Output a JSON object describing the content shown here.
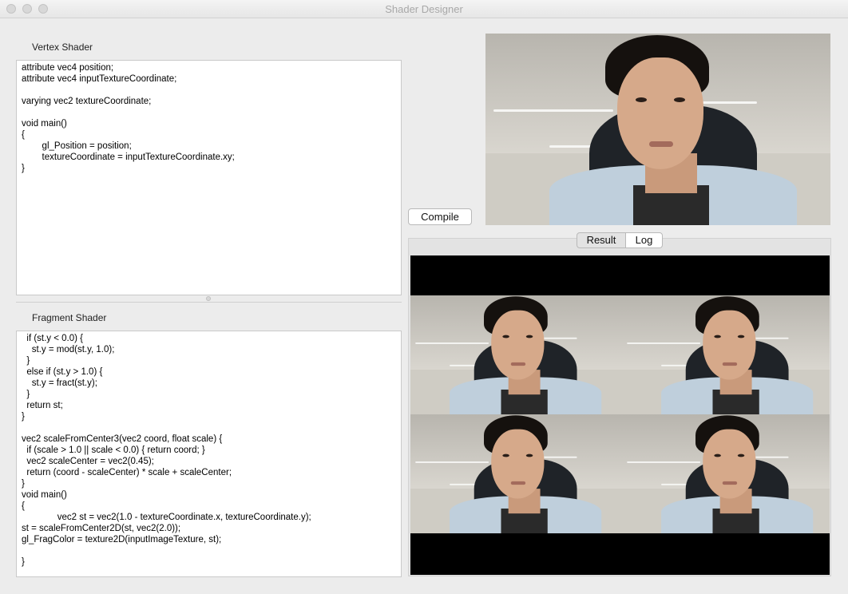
{
  "window": {
    "title": "Shader Designer"
  },
  "vertex": {
    "label": "Vertex Shader",
    "code": "attribute vec4 position;\nattribute vec4 inputTextureCoordinate;\n\nvarying vec2 textureCoordinate;\n\nvoid main()\n{\n        gl_Position = position;\n        textureCoordinate = inputTextureCoordinate.xy;\n}"
  },
  "fragment": {
    "label": "Fragment Shader",
    "code": "  if (st.y < 0.0) {\n    st.y = mod(st.y, 1.0);\n  }\n  else if (st.y > 1.0) {\n    st.y = fract(st.y);\n  }\n  return st;\n}\n\nvec2 scaleFromCenter3(vec2 coord, float scale) {\n  if (scale > 1.0 || scale < 0.0) { return coord; }\n  vec2 scaleCenter = vec2(0.45);\n  return (coord - scaleCenter) * scale + scaleCenter;\n}\nvoid main()\n{\n              vec2 st = vec2(1.0 - textureCoordinate.x, textureCoordinate.y);\nst = scaleFromCenter2D(st, vec2(2.0));\ngl_FragColor = texture2D(inputImageTexture, st);\n\n}"
  },
  "toolbar": {
    "compile_label": "Compile"
  },
  "output_tabs": [
    {
      "label": "Result",
      "selected": true
    },
    {
      "label": "Log",
      "selected": false
    }
  ],
  "colors": {
    "selected_tab": "#e3e3e3",
    "unselected_tab": "#ffffff",
    "result_background": "#000000"
  }
}
